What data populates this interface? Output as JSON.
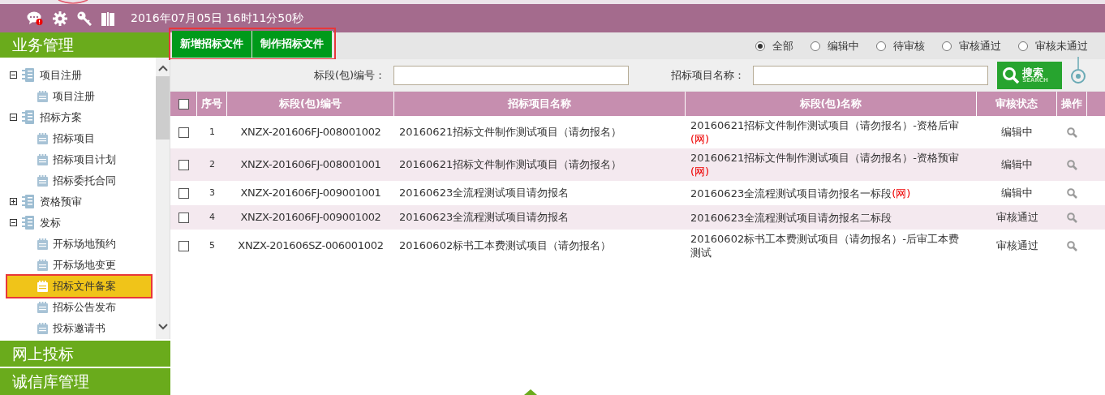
{
  "header": {
    "datetime": "2016年07月05日 16时11分50秒"
  },
  "sidebar": {
    "sections": [
      {
        "title": "业务管理",
        "tree": [
          {
            "label": "项目注册",
            "expanded": true,
            "selected": false,
            "children": [
              {
                "label": "项目注册",
                "selected": false
              }
            ]
          },
          {
            "label": "招标方案",
            "expanded": true,
            "selected": false,
            "children": [
              {
                "label": "招标项目",
                "selected": false
              },
              {
                "label": "招标项目计划",
                "selected": false
              },
              {
                "label": "招标委托合同",
                "selected": false
              }
            ]
          },
          {
            "label": "资格预审",
            "expanded": false,
            "selected": false
          },
          {
            "label": "发标",
            "expanded": true,
            "selected": false,
            "children": [
              {
                "label": "开标场地预约",
                "selected": false
              },
              {
                "label": "开标场地变更",
                "selected": false
              },
              {
                "label": "招标文件备案",
                "selected": true
              },
              {
                "label": "招标公告发布",
                "selected": false
              },
              {
                "label": "投标邀请书",
                "selected": false
              }
            ]
          }
        ]
      },
      {
        "title": "网上投标"
      },
      {
        "title": "诚信库管理"
      }
    ]
  },
  "toolbar": {
    "buttons": [
      "新增招标文件",
      "制作招标文件"
    ],
    "filters": [
      {
        "label": "全部",
        "selected": true
      },
      {
        "label": "编辑中",
        "selected": false
      },
      {
        "label": "待审核",
        "selected": false
      },
      {
        "label": "审核通过",
        "selected": false
      },
      {
        "label": "审核未通过",
        "selected": false
      }
    ]
  },
  "search": {
    "fields": [
      {
        "label": "标段(包)编号："
      },
      {
        "label": "招标项目名称："
      }
    ],
    "button": {
      "label": "搜索",
      "sublabel": "SEARCH"
    }
  },
  "table": {
    "all_checked": false,
    "columns": [
      "序号",
      "标段(包)编号",
      "招标项目名称",
      "标段(包)名称",
      "审核状态",
      "操作"
    ],
    "rows": [
      {
        "checked": false,
        "index": "1",
        "code": "XNZX-201606FJ-008001002",
        "project": "20160621招标文件制作测试项目（请勿报名）",
        "bid_name": [
          {
            "text": "20160621招标文件制作测试项目（请勿报名）-资格后审",
            "flagged": false
          },
          {
            "text": "(网)",
            "flagged": true
          }
        ],
        "status": "编辑中"
      },
      {
        "checked": false,
        "index": "2",
        "code": "XNZX-201606FJ-008001001",
        "project": "20160621招标文件制作测试项目（请勿报名）",
        "bid_name": [
          {
            "text": "20160621招标文件制作测试项目（请勿报名）-资格预审",
            "flagged": false
          },
          {
            "text": "(网)",
            "flagged": true
          }
        ],
        "status": "编辑中"
      },
      {
        "checked": false,
        "index": "3",
        "code": "XNZX-201606FJ-009001001",
        "project": "20160623全流程测试项目请勿报名",
        "bid_name": [
          {
            "text": "20160623全流程测试项目请勿报名一标段",
            "flagged": false
          },
          {
            "text": "(网)",
            "flagged": true
          }
        ],
        "status": "编辑中"
      },
      {
        "checked": false,
        "index": "4",
        "code": "XNZX-201606FJ-009001002",
        "project": "20160623全流程测试项目请勿报名",
        "bid_name": [
          {
            "text": "20160623全流程测试项目请勿报名二标段",
            "flagged": false
          }
        ],
        "status": "审核通过"
      },
      {
        "checked": false,
        "index": "5",
        "code": "XNZX-201606SZ-006001002",
        "project": "20160602标书工本费测试项目（请勿报名）",
        "bid_name": [
          {
            "text": "20160602标书工本费测试项目（请勿报名）-后审工本费测试",
            "flagged": false
          }
        ],
        "status": "审核通过"
      }
    ]
  }
}
